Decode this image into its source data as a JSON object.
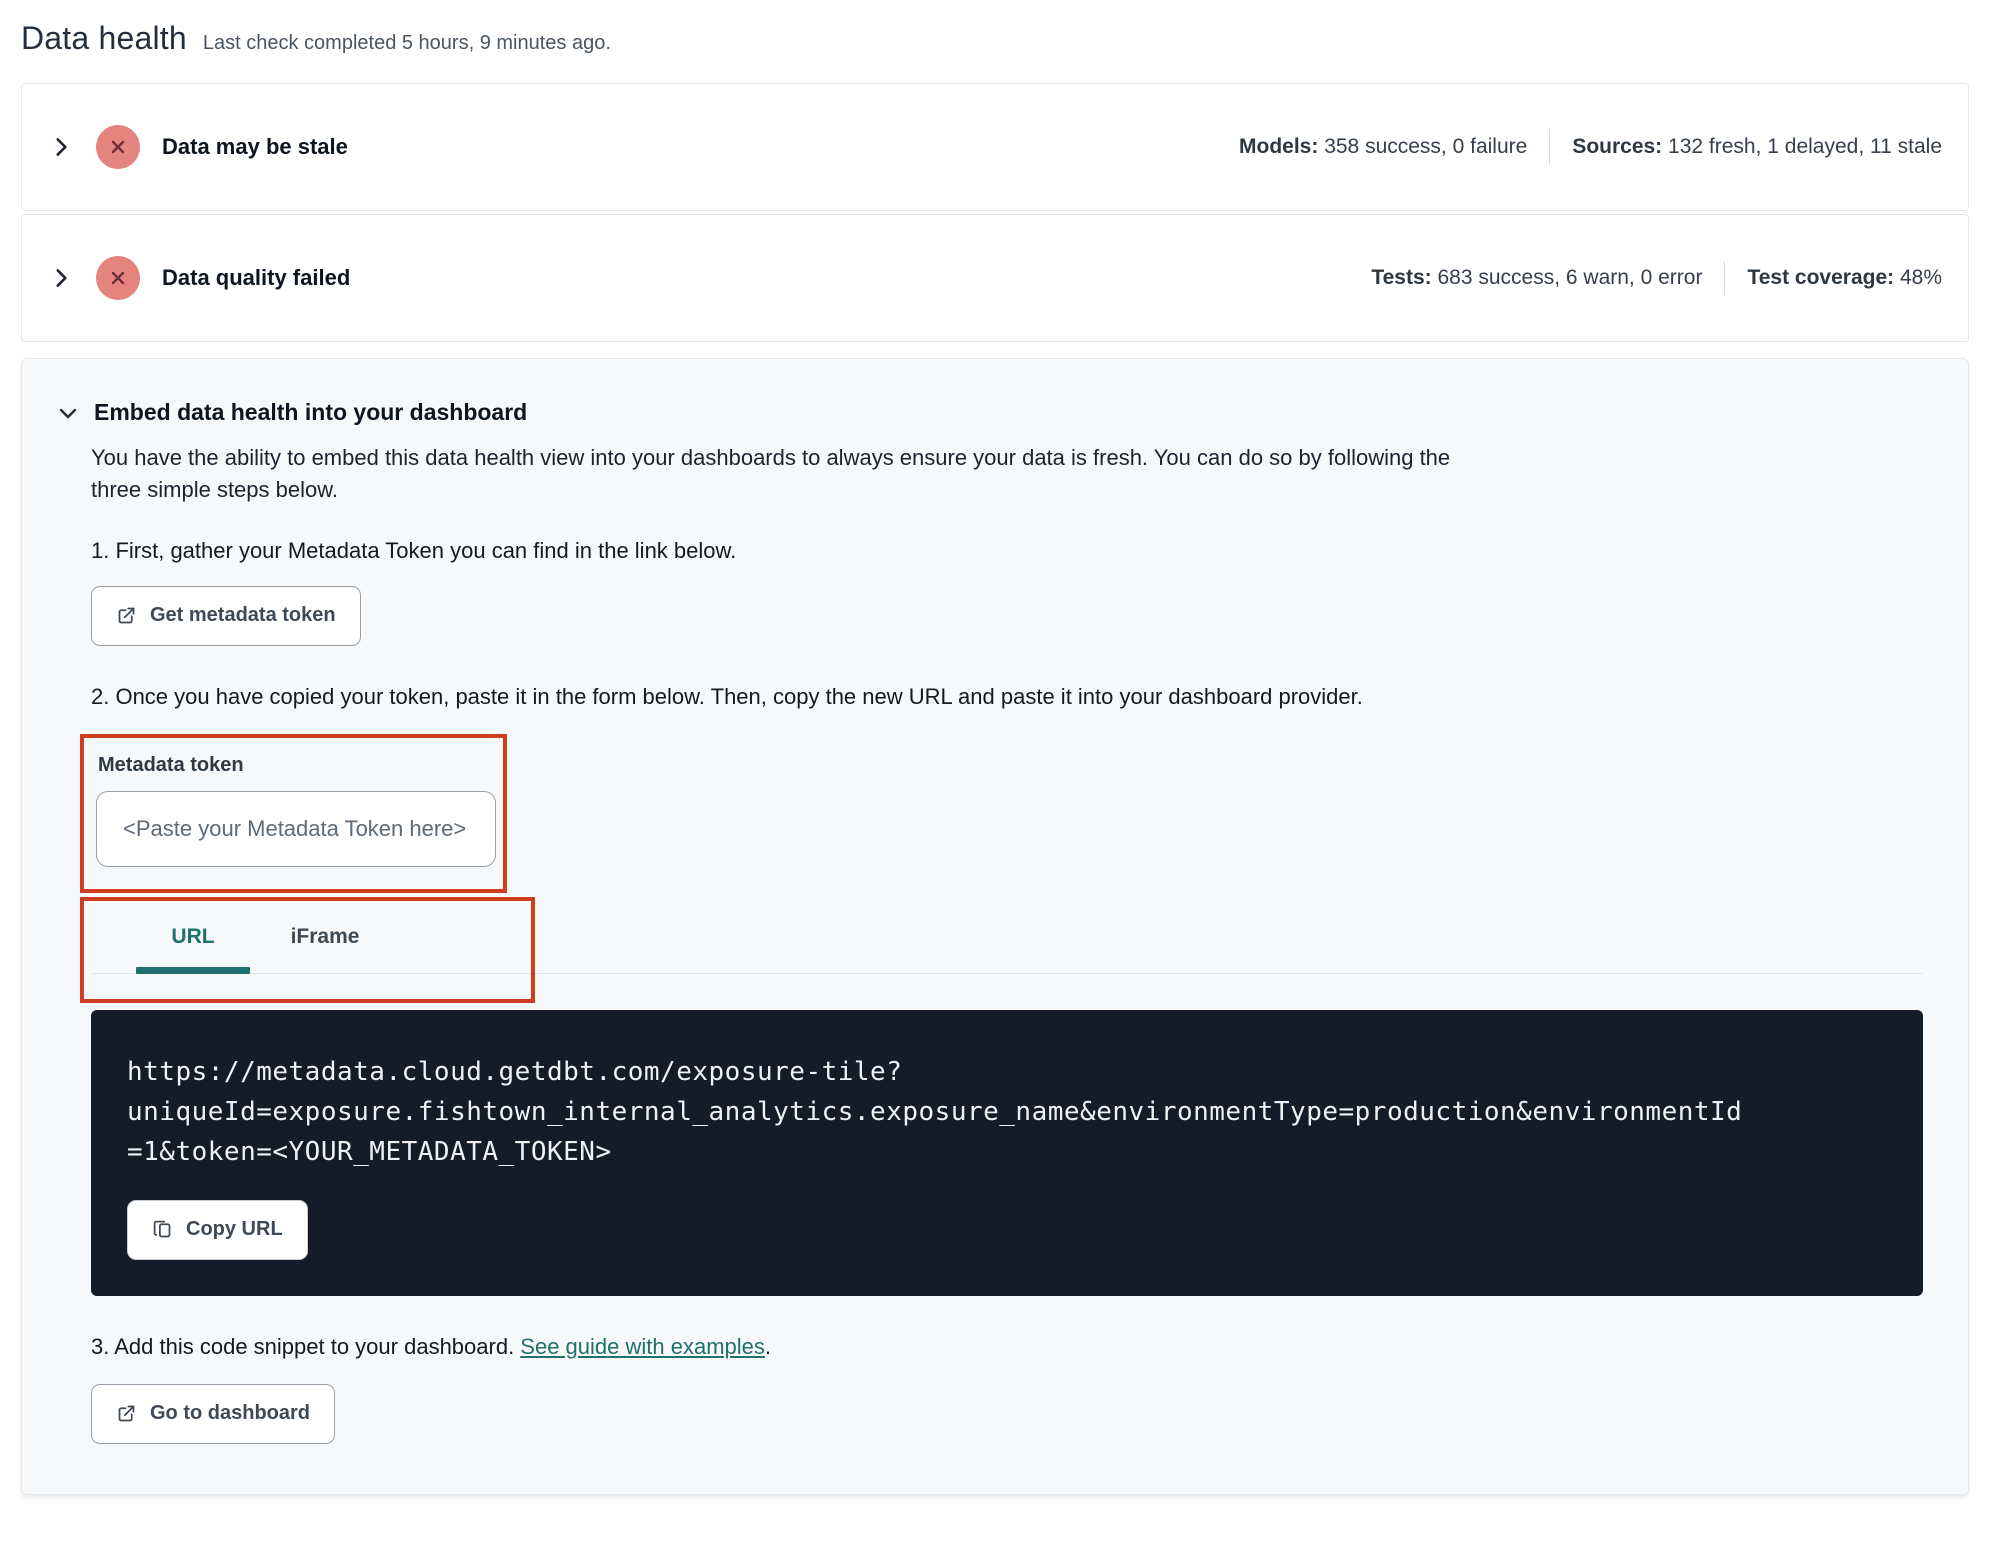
{
  "header": {
    "title": "Data health",
    "subtitle": "Last check completed 5 hours, 9 minutes ago."
  },
  "status_rows": [
    {
      "label": "Data may be stale",
      "stat1_label": "Models:",
      "stat1_value": "358 success, 0 failure",
      "stat2_label": "Sources:",
      "stat2_value": "132 fresh, 1 delayed, 11 stale"
    },
    {
      "label": "Data quality failed",
      "stat1_label": "Tests:",
      "stat1_value": "683 success, 6 warn, 0 error",
      "stat2_label": "Test coverage:",
      "stat2_value": "48%"
    }
  ],
  "embed": {
    "title": "Embed data health into your dashboard",
    "description": "You have the ability to embed this data health view into your dashboards to always ensure your data is fresh. You can do so by following the three simple steps below.",
    "step1_text": "1. First, gather your Metadata Token you can find in the link below.",
    "get_token_button": "Get metadata token",
    "step2_text": "2. Once you have copied your token, paste it in the form below. Then, copy the new URL and paste it into your dashboard provider.",
    "token_label": "Metadata token",
    "token_placeholder": "<Paste your Metadata Token here>",
    "tabs": [
      {
        "label": "URL"
      },
      {
        "label": "iFrame"
      }
    ],
    "code_url": "https://metadata.cloud.getdbt.com/exposure-tile?uniqueId=exposure.fishtown_internal_analytics.exposure_name&environmentType=production&environmentId=1&token=<YOUR_METADATA_TOKEN>",
    "code_lines": [
      "https://metadata.cloud.getdbt.com/exposure-tile?",
      "uniqueId=exposure.fishtown_internal_analytics.exposure_name&environmentType=production&environmentId",
      "=1&token=<YOUR_METADATA_TOKEN>"
    ],
    "copy_url_button": "Copy URL",
    "step3_text_before": "3. Add this code snippet to your dashboard. ",
    "step3_link": "See guide with examples",
    "step3_text_after": ".",
    "go_dashboard_button": "Go to dashboard"
  },
  "colors": {
    "accent_teal": "#20706d",
    "annotation_red": "#cf3d20",
    "error_badge_bg": "#e5837e",
    "error_badge_x": "#6b2e38",
    "code_block_bg": "#131c29"
  }
}
